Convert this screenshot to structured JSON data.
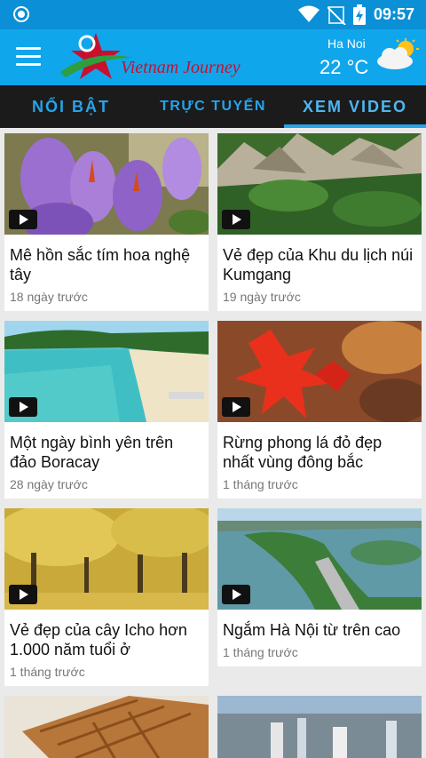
{
  "status_bar": {
    "time": "09:57",
    "icons": [
      "notification-circle-icon",
      "wifi-icon",
      "no-signal-icon",
      "battery-charging-icon"
    ]
  },
  "header": {
    "logo_text": "Vietnam Journey",
    "menu_icon": "hamburger-menu-icon",
    "weather": {
      "city": "Ha Noi",
      "temperature": "22 °C",
      "icon": "partly-cloudy-icon"
    }
  },
  "tabs": [
    {
      "label": "NỔI BẬT",
      "active": false
    },
    {
      "label": "TRỰC TUYẾN",
      "active": false
    },
    {
      "label": "XEM VIDEO",
      "active": true
    }
  ],
  "videos": [
    {
      "title": "Mê hồn sắc tím hoa nghệ tây",
      "time": "18 ngày trước"
    },
    {
      "title": "Vẻ đẹp của Khu du lịch núi Kumgang",
      "time": "19 ngày trước"
    },
    {
      "title": "Một ngày bình yên trên đảo Boracay",
      "time": "28 ngày trước"
    },
    {
      "title": "Rừng phong lá đỏ đẹp nhất vùng đông bắc",
      "time": "1 tháng trước"
    },
    {
      "title": "Vẻ đẹp của cây Icho hơn 1.000 năm tuổi ở",
      "time": "1 tháng trước"
    },
    {
      "title": "Ngắm Hà Nội từ trên cao",
      "time": "1 tháng trước"
    },
    {
      "title": "",
      "time": ""
    },
    {
      "title": "",
      "time": ""
    }
  ],
  "colors": {
    "status_bar": "#0b8fd6",
    "app_bar": "#10a6ec",
    "tab_bar": "#1b1b1b",
    "tab_text": "#27a3ea"
  }
}
